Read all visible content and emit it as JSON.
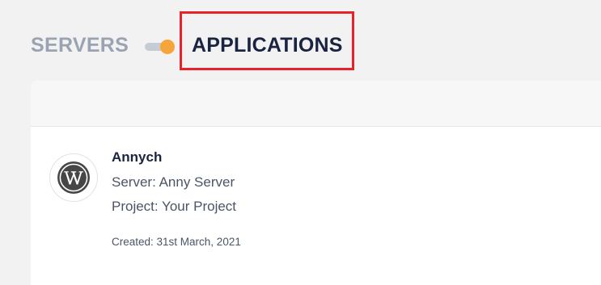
{
  "toggle": {
    "left_label": "SERVERS",
    "right_label": "APPLICATIONS",
    "selected": "APPLICATIONS",
    "knob_color": "#f6a53b",
    "highlight_color": "#e8222b"
  },
  "application": {
    "name": "Annych",
    "server": "Server: Anny Server",
    "project": "Project: Your Project",
    "created": "Created: 31st March, 2021",
    "icon": "wordpress-icon"
  }
}
